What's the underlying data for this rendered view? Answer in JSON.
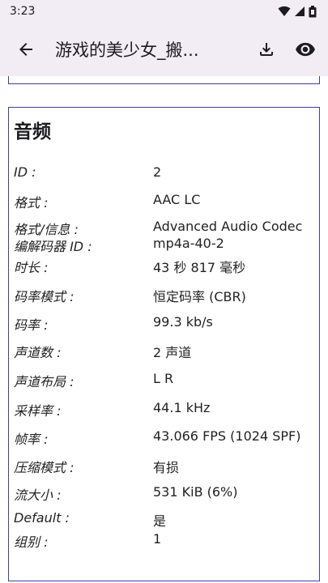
{
  "status_bar": {
    "time": "3:23"
  },
  "app_bar": {
    "title": "游戏的美少女_搬..."
  },
  "audio": {
    "heading": "音频",
    "rows": [
      {
        "key": "ID :",
        "value": "2"
      },
      {
        "key": "格式 :",
        "value": "AAC LC"
      },
      {
        "key": "格式/信息 :",
        "value": "Advanced Audio Codec"
      },
      {
        "key": "编解码器 ID :",
        "value": "mp4a-40-2"
      },
      {
        "key": "时长 :",
        "value": "43 秒 817 毫秒"
      },
      {
        "key": "码率模式 :",
        "value": "恒定码率 (CBR)"
      },
      {
        "key": "码率 :",
        "value": "99.3 kb/s"
      },
      {
        "key": "声道数 :",
        "value": "2 声道"
      },
      {
        "key": "声道布局 :",
        "value": "L R"
      },
      {
        "key": "采样率 :",
        "value": "44.1 kHz"
      },
      {
        "key": "帧率 :",
        "value": "43.066 FPS (1024 SPF)"
      },
      {
        "key": "压缩模式 :",
        "value": "有损"
      },
      {
        "key": "流大小 :",
        "value": "531 KiB (6%)"
      },
      {
        "key": "Default :",
        "value": "是"
      },
      {
        "key": "组别 :",
        "value": "1"
      }
    ]
  },
  "icons": {
    "back": "arrow-back-icon",
    "download": "download-icon",
    "view": "eye-icon",
    "wifi": "wifi-icon",
    "signal": "signal-icon",
    "battery": "battery-icon"
  }
}
